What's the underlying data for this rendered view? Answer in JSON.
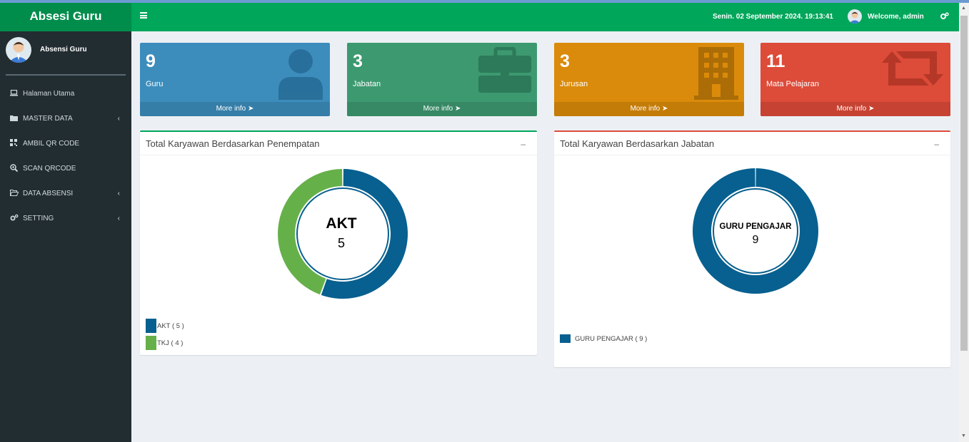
{
  "app": {
    "title": "Absesi Guru"
  },
  "navbar": {
    "datetime": "Senin. 02 September 2024. 19:13:41",
    "welcome": "Welcome, admin"
  },
  "sidebar": {
    "user_name": "Absensi Guru",
    "items": [
      {
        "label": "Halaman Utama",
        "icon": "laptop-icon"
      },
      {
        "label": "MASTER DATA",
        "icon": "folder-icon"
      },
      {
        "label": "AMBIL QR CODE",
        "icon": "qrcode-icon"
      },
      {
        "label": "SCAN QRCODE",
        "icon": "search-plus-icon"
      },
      {
        "label": "DATA ABSENSI",
        "icon": "folder-open-icon"
      },
      {
        "label": "SETTING",
        "icon": "cogs-icon"
      }
    ]
  },
  "stats": [
    {
      "value": "9",
      "label": "Guru",
      "more": "More info",
      "color": "#3c8dbc",
      "icon": "user-icon"
    },
    {
      "value": "3",
      "label": "Jabatan",
      "more": "More info",
      "color": "#3d9970",
      "icon": "briefcase-icon"
    },
    {
      "value": "3",
      "label": "Jurusan",
      "more": "More info",
      "color": "#db8b0b",
      "icon": "building-icon"
    },
    {
      "value": "11",
      "label": "Mata Pelajaran",
      "more": "More info",
      "color": "#dd4b39",
      "icon": "retweet-icon"
    }
  ],
  "charts": {
    "penempatan": {
      "title": "Total Karyawan Berdasarkan Penempatan",
      "center_label": "AKT",
      "center_value": "5"
    },
    "jabatan": {
      "title": "Total Karyawan Berdasarkan Jabatan",
      "center_label": "GURU PENGAJAR",
      "center_value": "9"
    }
  },
  "chart_data": [
    {
      "type": "pie",
      "donut": true,
      "categories": [
        "AKT",
        "TKJ"
      ],
      "values": [
        5,
        4
      ],
      "colors": [
        "#07608f",
        "#66b04a"
      ],
      "legend": [
        "AKT ( 5 )",
        "TKJ ( 4 )"
      ]
    },
    {
      "type": "pie",
      "donut": true,
      "categories": [
        "GURU PENGAJAR"
      ],
      "values": [
        9
      ],
      "colors": [
        "#07608f"
      ],
      "legend": [
        "GURU PENGAJAR ( 9 )"
      ]
    }
  ]
}
